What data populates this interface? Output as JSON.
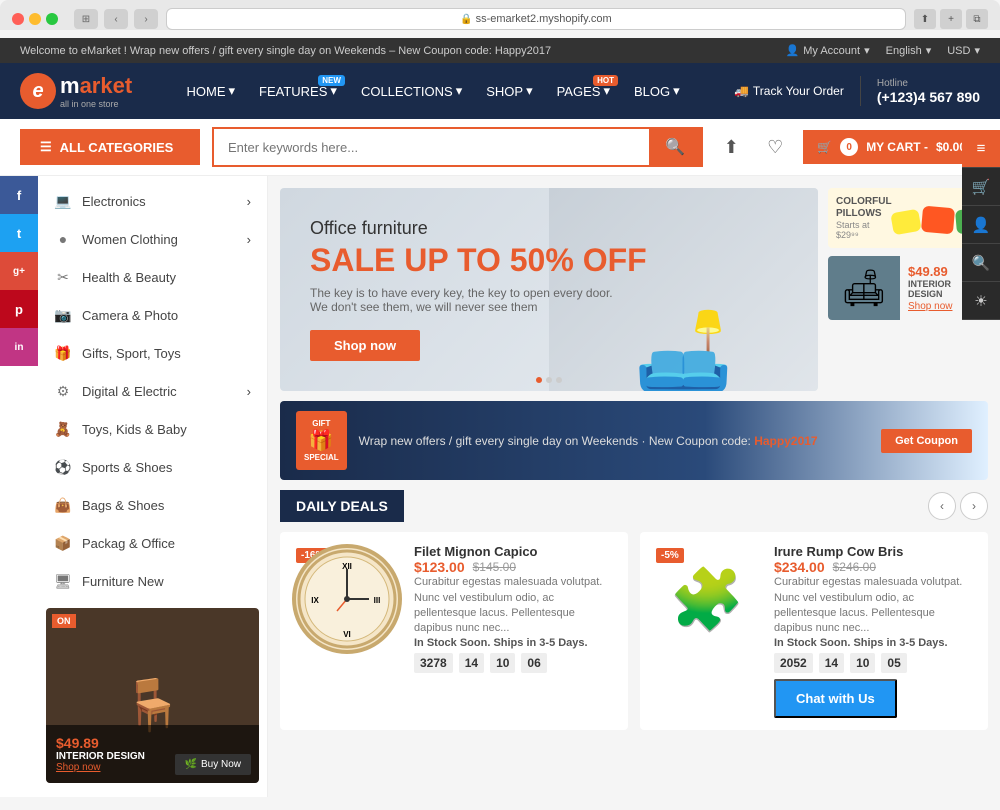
{
  "browser": {
    "url": "ss-emarket2.myshopify.com",
    "refresh_icon": "↻"
  },
  "topbar": {
    "message": "Welcome to eMarket ! Wrap new offers / gift every single day on Weekends – New Coupon code: Happy2017",
    "account": "My Account",
    "language": "English",
    "currency": "USD"
  },
  "logo": {
    "icon_letter": "e",
    "brand": "market",
    "tagline": "all in one store"
  },
  "nav": {
    "items": [
      {
        "label": "HOME",
        "has_dropdown": true,
        "badge": ""
      },
      {
        "label": "FEATURES",
        "has_dropdown": true,
        "badge": "NEW",
        "badge_color": "blue"
      },
      {
        "label": "COLLECTIONS",
        "has_dropdown": true,
        "badge": ""
      },
      {
        "label": "SHOP",
        "has_dropdown": true,
        "badge": ""
      },
      {
        "label": "PAGES",
        "has_dropdown": true,
        "badge": "HOT",
        "badge_color": "red"
      },
      {
        "label": "BLOG",
        "has_dropdown": true,
        "badge": ""
      }
    ]
  },
  "header_right": {
    "track_label": "Track Your Order",
    "hotline_label": "Hotline",
    "hotline_number": "(+123)4 567 890"
  },
  "toolbar": {
    "categories_label": "ALL CATEGORIES",
    "search_placeholder": "Enter keywords here...",
    "cart_count": "0",
    "cart_label": "MY CART -",
    "cart_price": "$0.00"
  },
  "social": [
    {
      "name": "Facebook",
      "letter": "f"
    },
    {
      "name": "Twitter",
      "letter": "t"
    },
    {
      "name": "Google+",
      "letter": "g+"
    },
    {
      "name": "Pinterest",
      "letter": "p"
    },
    {
      "name": "Instagram",
      "letter": "in"
    }
  ],
  "right_icons": [
    "≡",
    "🛒",
    "👤",
    "🔍",
    "☀"
  ],
  "categories": [
    {
      "label": "Electronics",
      "icon": "💻",
      "has_sub": true
    },
    {
      "label": "Women Clothing",
      "icon": "👗",
      "has_sub": true
    },
    {
      "label": "Health & Beauty",
      "icon": "✂",
      "has_sub": false
    },
    {
      "label": "Camera & Photo",
      "icon": "📷",
      "has_sub": false
    },
    {
      "label": "Gifts, Sport, Toys",
      "icon": "🎁",
      "has_sub": false
    },
    {
      "label": "Digital & Electric",
      "icon": "⚡",
      "has_sub": true
    },
    {
      "label": "Toys, Kids & Baby",
      "icon": "🧸",
      "has_sub": false
    },
    {
      "label": "Sports & Shoes",
      "icon": "⚽",
      "has_sub": false
    },
    {
      "label": "Bags & Shoes",
      "icon": "👜",
      "has_sub": false
    },
    {
      "label": "Packag & Office",
      "icon": "📦",
      "has_sub": false
    },
    {
      "label": "Furniture New",
      "icon": "🖥",
      "has_sub": false
    }
  ],
  "hero": {
    "subtitle": "Office furniture",
    "title": "SALE UP TO 50% OFF",
    "description": "The key is to have every key, the key to open every door.\nWe don't see them, we will never see them",
    "btn_label": "Shop now"
  },
  "right_banners": {
    "banner1": {
      "heading": "COLORFUL\nPILLOWS",
      "starts_at": "Starts at $29⁹⁹"
    },
    "banner2": {
      "price": "$49.89",
      "label": "INTERIOR DESIGN",
      "shop_label": "Shop now"
    }
  },
  "gift_banner": {
    "tag1": "GIFT",
    "tag2": "SPECIAL",
    "icon": "🎁",
    "text": "Wrap new offers / gift every single day on Weekends · New Coupon code: ",
    "coupon": "Happy2017",
    "btn_label": "Get Coupon"
  },
  "daily_deals": {
    "title": "DAILY DEALS",
    "products": [
      {
        "name": "Filet Mignon Capico",
        "badge": "-16%",
        "price": "$123.00",
        "original_price": "$145.00",
        "description": "Curabitur egestas malesuada volutpat. Nunc vel vestibulum odio, ac pellentesque lacus. Pellentesque dapibus nunc nec...",
        "stock": "In Stock Soon. Ships in 3-5 Days.",
        "timer": [
          "3278",
          "14",
          "10",
          "06"
        ]
      },
      {
        "name": "Irure Rump Cow Bris",
        "badge": "-5%",
        "price": "$234.00",
        "original_price": "$246.00",
        "description": "Curabitur egestas malesuada volutpat. Nunc vel vestibulum odio, ac pellentesque lacus. Pellentesque dapibus nunc nec...",
        "stock": "In Stock Soon. Ships in 3-5 Days.",
        "timer": [
          "2052",
          "14",
          "10",
          "05"
        ]
      }
    ]
  },
  "left_bottom_banner": {
    "tag": "ON",
    "price": "$49.89",
    "title": "INTERIOR DESIGN",
    "link": "Shop now",
    "btn": "Buy Now"
  },
  "chat": {
    "label": "Chat with Us"
  }
}
